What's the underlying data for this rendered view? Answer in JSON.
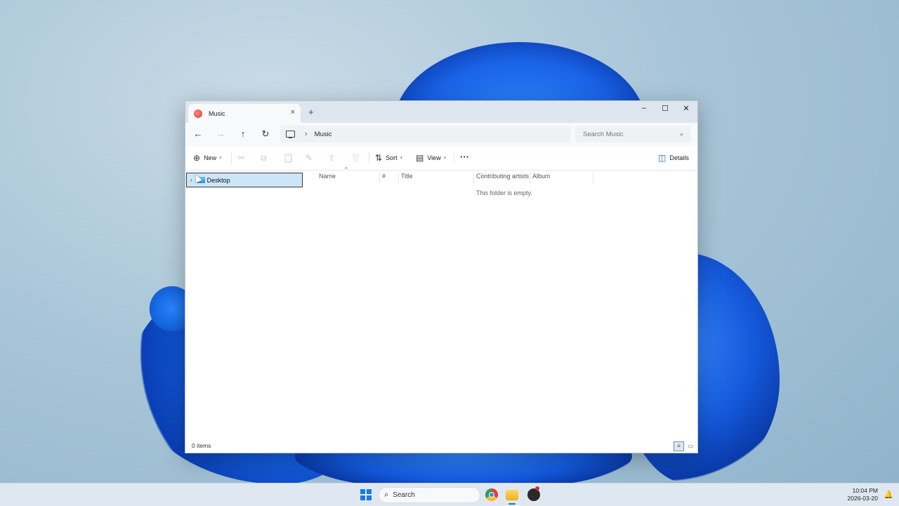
{
  "window": {
    "tab_title": "Music",
    "tab_close": "×",
    "new_tab": "+",
    "controls": {
      "minimize": "–",
      "maximize": "☐",
      "close": "✕"
    }
  },
  "nav": {
    "back": "←",
    "forward": "→",
    "up": "↑",
    "refresh": "↻",
    "breadcrumb_separator": "›",
    "breadcrumb": "Music",
    "search_placeholder": "Search Music",
    "search_icon": "⌕"
  },
  "toolbar": {
    "new_label": "New",
    "new_icon": "⊕",
    "cut_icon": "✂",
    "copy_icon": "⧉",
    "paste_icon": "📋",
    "rename_icon": "✎",
    "share_icon": "⇪",
    "delete_icon": "🗑",
    "sort_label": "Sort",
    "sort_icon": "⇅",
    "view_label": "View",
    "view_icon": "▤",
    "more_icon": "···",
    "details_label": "Details",
    "details_icon": "◫"
  },
  "navpane": {
    "items": [
      {
        "label": "Desktop",
        "chevron": "›"
      }
    ]
  },
  "columns": {
    "sort_indicator": "^",
    "headers": [
      "Name",
      "#",
      "Title",
      "Contributing artists",
      "Album"
    ]
  },
  "content": {
    "empty_message": "This folder is empty."
  },
  "status": {
    "item_count": "0 items"
  },
  "taskbar": {
    "search_label": "Search",
    "search_icon": "⌕",
    "time": "10:04 PM",
    "date": "2026-03-20",
    "notification_icon": "🔔"
  },
  "colors": {
    "accent": "#1a7ae6",
    "selection": "#cde5f7",
    "title_bar": "#dde6ef"
  }
}
